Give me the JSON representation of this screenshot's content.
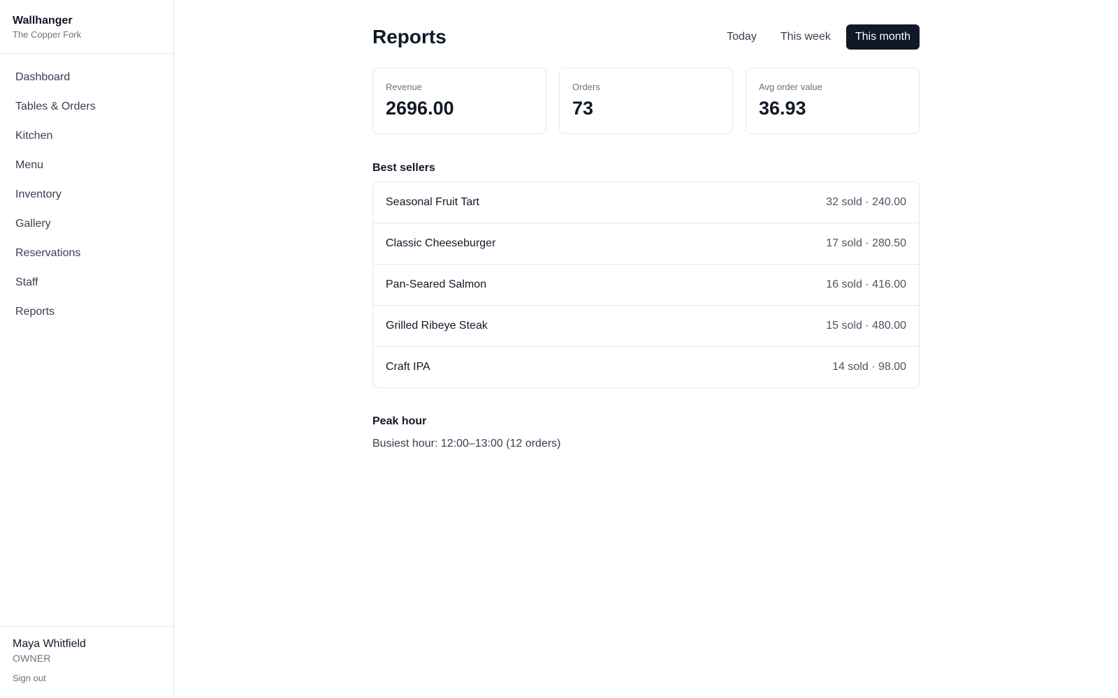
{
  "brand": {
    "name": "Wallhanger",
    "restaurant": "The Copper Fork"
  },
  "sidebar": {
    "items": [
      {
        "label": "Dashboard"
      },
      {
        "label": "Tables & Orders"
      },
      {
        "label": "Kitchen"
      },
      {
        "label": "Menu"
      },
      {
        "label": "Inventory"
      },
      {
        "label": "Gallery"
      },
      {
        "label": "Reservations"
      },
      {
        "label": "Staff"
      },
      {
        "label": "Reports"
      }
    ]
  },
  "user": {
    "name": "Maya Whitfield",
    "role": "OWNER",
    "signout_label": "Sign out"
  },
  "page": {
    "title": "Reports",
    "ranges": [
      {
        "label": "Today",
        "active": false
      },
      {
        "label": "This week",
        "active": false
      },
      {
        "label": "This month",
        "active": true
      }
    ]
  },
  "stats": [
    {
      "label": "Revenue",
      "value": "2696.00"
    },
    {
      "label": "Orders",
      "value": "73"
    },
    {
      "label": "Avg order value",
      "value": "36.93"
    }
  ],
  "best_sellers": {
    "title": "Best sellers",
    "items": [
      {
        "name": "Seasonal Fruit Tart",
        "meta": "32 sold · 240.00"
      },
      {
        "name": "Classic Cheeseburger",
        "meta": "17 sold · 280.50"
      },
      {
        "name": "Pan-Seared Salmon",
        "meta": "16 sold · 416.00"
      },
      {
        "name": "Grilled Ribeye Steak",
        "meta": "15 sold · 480.00"
      },
      {
        "name": "Craft IPA",
        "meta": "14 sold · 98.00"
      }
    ]
  },
  "peak_hour": {
    "title": "Peak hour",
    "text": "Busiest hour: 12:00–13:00 (12 orders)"
  },
  "colors": {
    "active_tab_bg": "#111827",
    "border": "#e5e7eb",
    "muted_text": "#6b7280"
  }
}
